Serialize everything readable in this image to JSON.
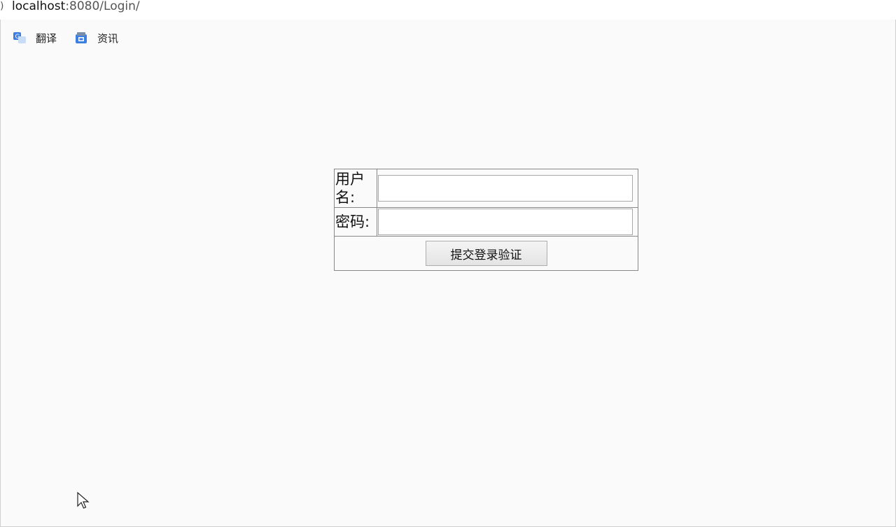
{
  "browser": {
    "nav_glyph": ")",
    "url_host": "localhost",
    "url_rest": ":8080/Login/"
  },
  "bookmarks": [
    {
      "label": "翻译",
      "icon": "translate-icon"
    },
    {
      "label": "资讯",
      "icon": "news-icon"
    }
  ],
  "login_form": {
    "username_label": "用户名:",
    "username_value": "",
    "password_label": "密码:",
    "password_value": "",
    "submit_label": "提交登录验证"
  },
  "colors": {
    "page_background": "#fafafa",
    "border": "#555555",
    "button_background": "#e9e9e9",
    "bookmark_icon_blue": "#3d7fe0"
  }
}
